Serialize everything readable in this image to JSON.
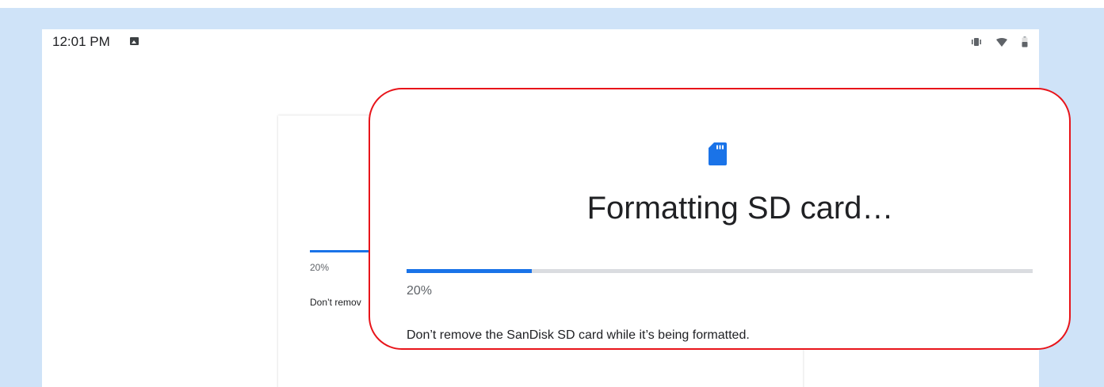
{
  "status_bar": {
    "time": "12:01 PM",
    "icons": [
      "image-notification-icon",
      "vibrate-icon",
      "wifi-icon",
      "battery-icon"
    ]
  },
  "dialog": {
    "icon": "sd-card-icon",
    "title": "Formatting SD card…",
    "progress": 0.2,
    "percent_label": "20%",
    "message": "Don’t remove the SanDisk SD card while it’s being formatted.",
    "message_clipped": "Don’t remov"
  },
  "colors": {
    "accent": "#1a73e8",
    "callout_border": "#e8141a",
    "backdrop": "#cfe3f8"
  }
}
